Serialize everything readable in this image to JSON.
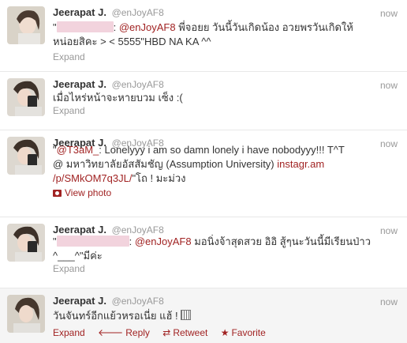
{
  "tweets": [
    {
      "fullname": "Jeerapat J.",
      "username": "@enJoyAF8",
      "time": "now",
      "text_prefix": "\"",
      "mention": "@enJoyAF8",
      "text_line1_rest": " พี่จอยย วันนี้วันเกิดน้อง อวยพรวันเกิดให้",
      "text_line2": "หน่อยสิคะ > < 5555\"HBD NA KA ^^",
      "expand": "Expand"
    },
    {
      "fullname": "Jeerapat J.",
      "username": "@enJoyAF8",
      "time": "now",
      "text": "เมื่อไหร่หน้าจะหายบวม เซ็ง :(",
      "expand": "Expand"
    },
    {
      "fullname": "Jeerapat J.",
      "username": "@enJoyAF8",
      "time": "now",
      "text_prefix": "\"",
      "mention": "@T3aM_",
      "text_line1_rest": ": Lonelyyy i am so damn lonely i have nobodyyy!!! T^T",
      "text_line2_prefix": "@ มหาวิทยาลัยอัสสัมชัญ (Assumption University) ",
      "link_part1": "instagr.am",
      "link_part2": "/p/SMkOM7q3JL/",
      "text_line3_rest": "\"โถ ! มะม่วง",
      "view_photo": "View photo"
    },
    {
      "fullname": "Jeerapat J.",
      "username": "@enJoyAF8",
      "time": "now",
      "text_prefix": "\"",
      "mention": "@enJoyAF8",
      "text_line1_rest": " มอนิ่งจ้าสุดสวย อิอิ สู้ๆนะวันนี้มีเรียนป่าว",
      "text_line2": "^___^\"มีค่ะ",
      "expand": "Expand"
    },
    {
      "fullname": "Jeerapat J.",
      "username": "@enJoyAF8",
      "time": "now",
      "text": "วันจันทร์อีกแย้วหรอเนี่ย แฮ้ ! ",
      "actions": {
        "expand": "Expand",
        "reply": "Reply",
        "retweet": "Retweet",
        "favorite": "Favorite"
      }
    }
  ],
  "icons": {
    "reply": "reply-arrow-icon",
    "retweet": "retweet-icon",
    "favorite": "star-icon",
    "photo": "photo-icon"
  },
  "colors": {
    "link": "#a12323",
    "meta": "#999999",
    "redaction": "#f2d3dd"
  }
}
